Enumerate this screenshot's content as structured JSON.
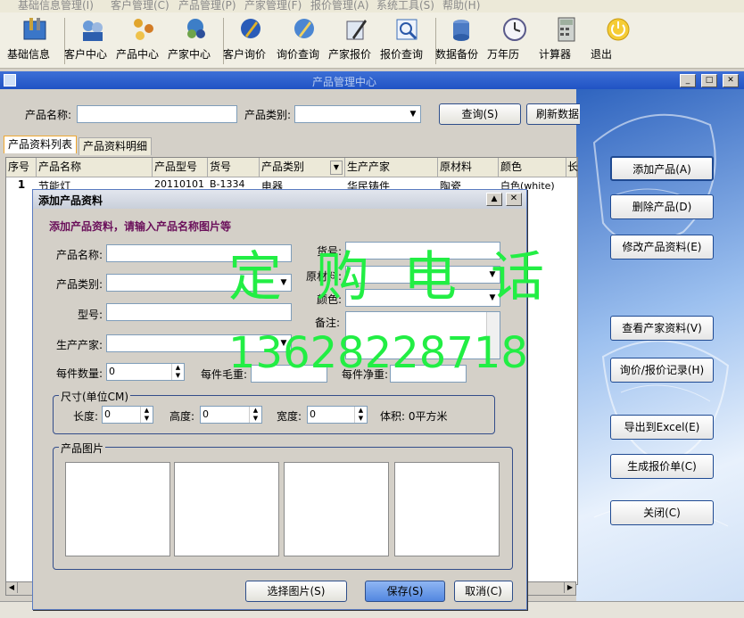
{
  "menu": [
    "基础信息管理(I)",
    "客户管理(C)",
    "产品管理(P)",
    "产家管理(F)",
    "报价管理(A)",
    "系统工具(S)",
    "帮助(H)"
  ],
  "toolbar": {
    "items": [
      {
        "label": "基础信息",
        "icon": "toolbox-icon"
      },
      {
        "label": "客户中心",
        "icon": "customers-icon"
      },
      {
        "label": "产品中心",
        "icon": "products-icon"
      },
      {
        "label": "产家中心",
        "icon": "factories-icon"
      },
      {
        "label": "客户询价",
        "icon": "customer-inquiry-icon"
      },
      {
        "label": "询价查询",
        "icon": "inquiry-search-icon"
      },
      {
        "label": "产家报价",
        "icon": "factory-quote-icon"
      },
      {
        "label": "报价查询",
        "icon": "quote-search-icon"
      },
      {
        "label": "数据备份",
        "icon": "backup-icon"
      },
      {
        "label": "万年历",
        "icon": "calendar-icon"
      },
      {
        "label": "计算器",
        "icon": "calculator-icon"
      },
      {
        "label": "退出",
        "icon": "exit-icon"
      }
    ]
  },
  "window": {
    "title": "产品管理中心"
  },
  "search": {
    "product_name_label": "产品名称:",
    "product_name_value": "",
    "category_label": "产品类别:",
    "category_value": "",
    "query_button": "查询(S)",
    "refresh_button": "刷新数据"
  },
  "tabs": [
    {
      "label": "产品资料列表",
      "active": true
    },
    {
      "label": "产品资料明细",
      "active": false
    }
  ],
  "grid": {
    "columns": [
      "序号",
      "产品名称",
      "产品型号",
      "货号",
      "产品类别",
      "生产产家",
      "原材料",
      "颜色",
      "长"
    ],
    "rows": [
      [
        "1",
        "节能灯",
        "20110101",
        "B-1334",
        "电器",
        "华民铸件",
        "陶瓷",
        "白色(white)",
        ""
      ]
    ]
  },
  "actions": [
    "添加产品(A)",
    "删除产品(D)",
    "修改产品资料(E)",
    "查看产家资料(V)",
    "询价/报价记录(H)",
    "导出到Excel(E)",
    "生成报价单(C)",
    "关闭(C)"
  ],
  "dialog": {
    "title": "添加产品资料",
    "subtitle": "添加产品资料，请输入产品名称图片等",
    "labels": {
      "name": "产品名称:",
      "category": "产品类别:",
      "model": "型号:",
      "maker": "生产产家:",
      "sku": "货号:",
      "material": "原材料:",
      "color": "颜色:",
      "note": "备注:",
      "qty": "每件数量:",
      "gross": "每件毛重:",
      "net": "每件净重:"
    },
    "qty_value": "0",
    "size_group": {
      "title": "尺寸(单位CM)",
      "length_label": "长度:",
      "length_value": "0",
      "height_label": "高度:",
      "height_value": "0",
      "width_label": "宽度:",
      "width_value": "0",
      "volume": "体积: 0平方米"
    },
    "photo_group": {
      "title": "产品图片"
    },
    "buttons": {
      "select_photo": "选择图片(S)",
      "save": "保存(S)",
      "cancel": "取消(C)"
    }
  },
  "watermark": {
    "line1": "定购电话",
    "line2": "13628228718"
  },
  "colors": {
    "watermark": "#22ee44",
    "dialog_subtitle": "#6a0f5a",
    "title_bar": "#2f5fc9"
  }
}
